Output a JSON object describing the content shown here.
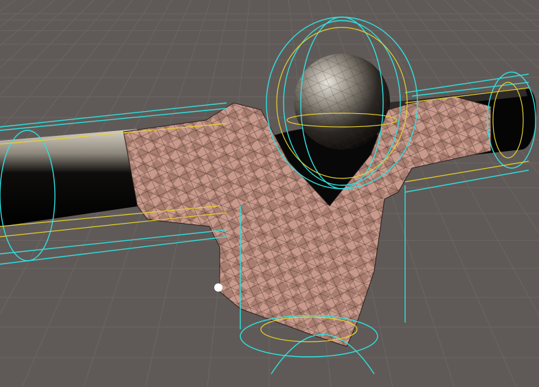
{
  "scene": {
    "view": "3d-scene-viewport",
    "background_color": "#5f5a57",
    "grid_color": "#6d6865",
    "collider_color": "#2fe0e0",
    "bounds_color": "#e8d22a",
    "cloth_color": "#c99a8c",
    "cloth_dark_color": "#b0827a",
    "body_color": "#0a0a0a",
    "head_color": "#3a352f",
    "cursor_color": "#ffffff",
    "objects": [
      {
        "name": "head-sphere",
        "kind": "sphere-mesh"
      },
      {
        "name": "left-arm-capsule",
        "kind": "capsule-mesh"
      },
      {
        "name": "right-arm-capsule",
        "kind": "capsule-mesh"
      },
      {
        "name": "torso-capsule",
        "kind": "capsule-mesh"
      },
      {
        "name": "cloth-shirt",
        "kind": "cloth-mesh"
      }
    ]
  }
}
